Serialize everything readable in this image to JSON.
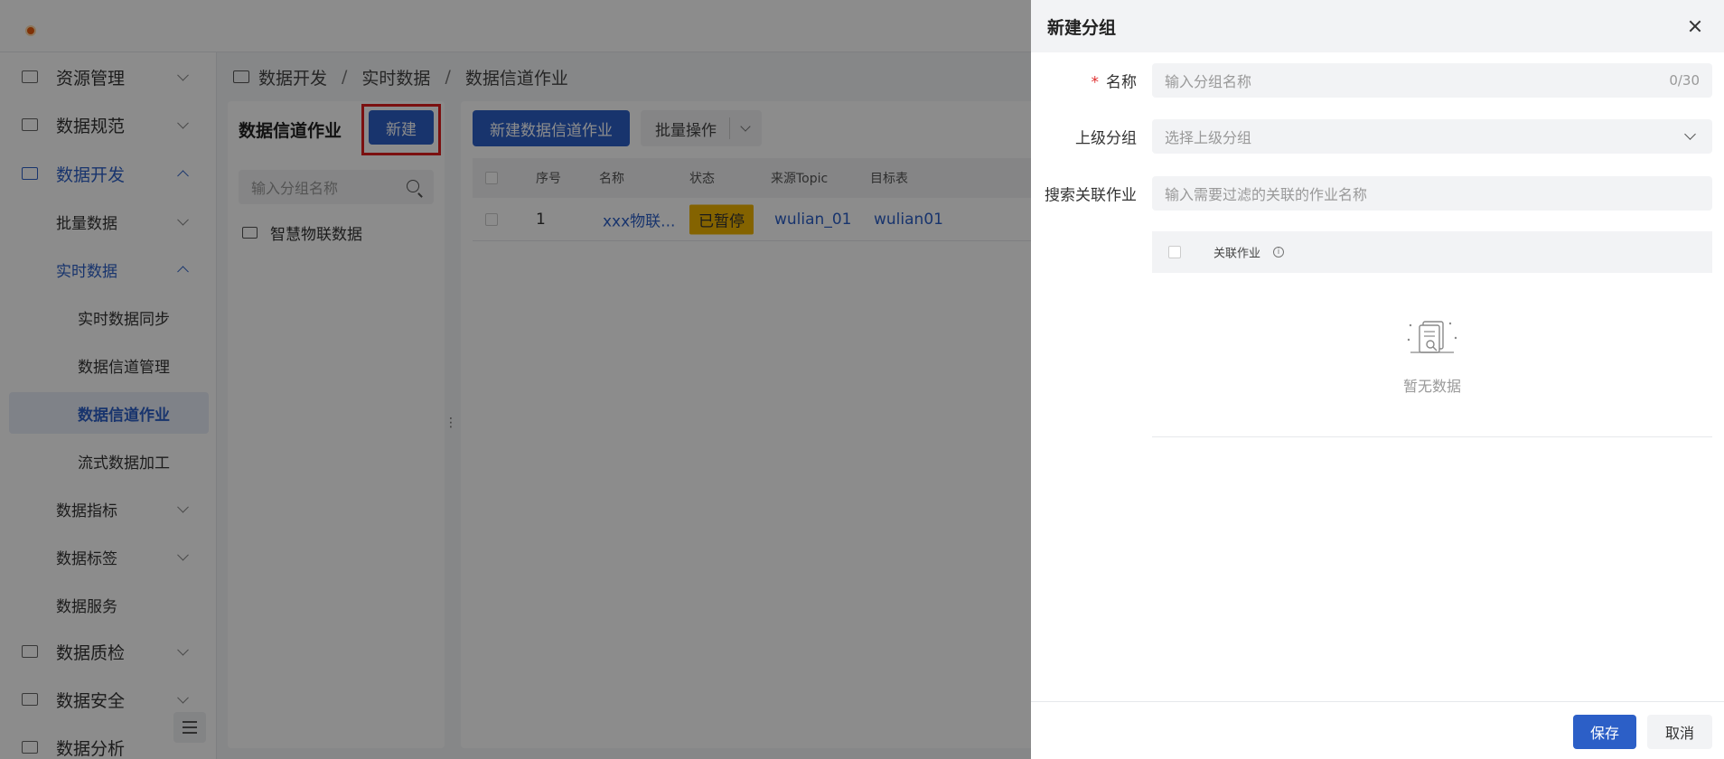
{
  "sidebar": {
    "items": [
      {
        "label": "资源管理"
      },
      {
        "label": "数据规范"
      },
      {
        "label": "数据开发"
      },
      {
        "label": "批量数据"
      },
      {
        "label": "实时数据"
      },
      {
        "label": "实时数据同步"
      },
      {
        "label": "数据信道管理"
      },
      {
        "label": "数据信道作业"
      },
      {
        "label": "流式数据加工"
      },
      {
        "label": "数据指标"
      },
      {
        "label": "数据标签"
      },
      {
        "label": "数据服务"
      },
      {
        "label": "数据质检"
      },
      {
        "label": "数据安全"
      },
      {
        "label": "数据分析"
      }
    ]
  },
  "breadcrumb": [
    "数据开发",
    "实时数据",
    "数据信道作业"
  ],
  "group_panel": {
    "title": "数据信道作业",
    "new_label": "新建",
    "search_placeholder": "输入分组名称",
    "tree": [
      {
        "label": "智慧物联数据"
      }
    ]
  },
  "main": {
    "primary_label": "新建数据信道作业",
    "batch_label": "批量操作",
    "columns": [
      "序号",
      "名称",
      "状态",
      "来源Topic",
      "目标表"
    ],
    "rows": [
      {
        "index": "1",
        "name": "xxx物联...",
        "status": "已暂停",
        "source_topic": "wulian_01",
        "target": "wulian01"
      }
    ]
  },
  "drawer": {
    "title": "新建分组",
    "name_label": "名称",
    "name_placeholder": "输入分组名称",
    "name_counter": "0/30",
    "parent_label": "上级分组",
    "parent_placeholder": "选择上级分组",
    "search_label": "搜索关联作业",
    "search_placeholder": "输入需要过滤的关联的作业名称",
    "table_header": "关联作业",
    "empty_text": "暂无数据",
    "save_label": "保存",
    "cancel_label": "取消"
  },
  "colors": {
    "primary": "#2c5fc7",
    "status_paused": "#f0b400",
    "highlight": "#e01e1e"
  }
}
